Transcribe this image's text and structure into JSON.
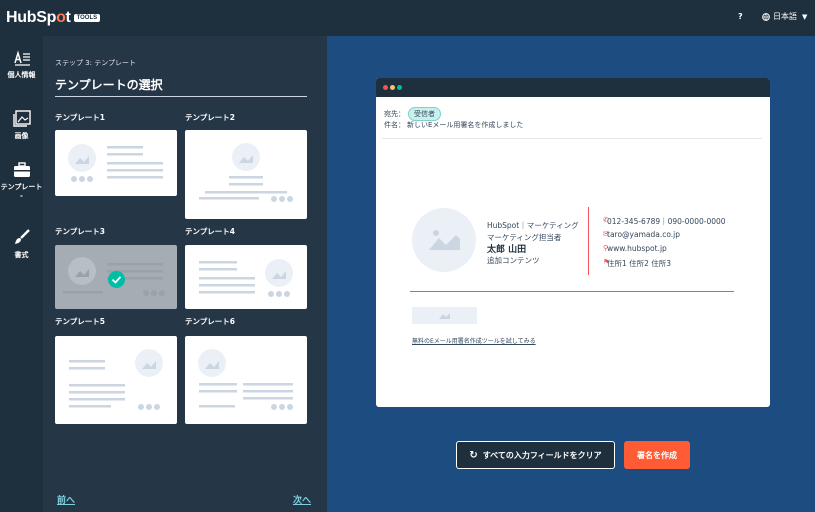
{
  "app": {
    "logo_text_pre": "HubSp",
    "logo_text_o": "o",
    "logo_text_post": "t",
    "tools_badge": "TOOLS",
    "help": "?",
    "language": "日本語"
  },
  "rail": {
    "items": [
      {
        "label": "個人情報",
        "icon": "person-card-icon"
      },
      {
        "label": "画像",
        "icon": "image-icon"
      },
      {
        "label": "テンプレート",
        "icon": "toolbox-icon"
      },
      {
        "label": "書式",
        "icon": "brush-icon"
      }
    ]
  },
  "panel": {
    "step": "ステップ 3: テンプレート",
    "title": "テンプレートの選択",
    "templates": [
      {
        "label": "テンプレート1"
      },
      {
        "label": "テンプレート2"
      },
      {
        "label": "テンプレート3",
        "selected": true
      },
      {
        "label": "テンプレート4"
      },
      {
        "label": "テンプレート5"
      },
      {
        "label": "テンプレート6"
      }
    ],
    "prev": "前へ",
    "next": "次へ"
  },
  "preview": {
    "to_label": "宛先：",
    "to_value": "受信者",
    "subject_label": "件名：",
    "subject_value": "新しいEメール用署名を作成しました",
    "company": "HubSpot｜マーケティング",
    "role": "マーケティング担当者",
    "name": "太郎 山田",
    "extra": "追加コンテンツ",
    "phone": "012-345-6789｜090-0000-0000",
    "email": "taro@yamada.co.jp",
    "website": "www.hubspot.jp",
    "address": "住所1 住所2 住所3",
    "link": "無料のEメール用署名作成ツールを試してみる"
  },
  "actions": {
    "clear": "すべての入力フィールドをクリア",
    "create": "署名を作成"
  },
  "colors": {
    "accent": "#ff5c35",
    "dark": "#1e2f3d",
    "panel": "#253646",
    "main_bg": "#1d4d80",
    "signature_line": "#f2545b"
  }
}
